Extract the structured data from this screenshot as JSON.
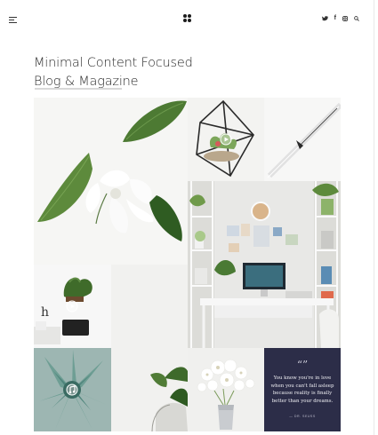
{
  "header": {
    "menu_icon": "hamburger-icon",
    "logo_icon": "four-dot-logo",
    "social": [
      {
        "name": "twitter-icon",
        "glyph": "ⓣ",
        "label": "y"
      },
      {
        "name": "facebook-icon",
        "glyph": "f",
        "label": "f"
      },
      {
        "name": "instagram-icon",
        "glyph": "▢",
        "label": "□"
      },
      {
        "name": "search-icon",
        "glyph": "⌕",
        "label": "⌕"
      }
    ]
  },
  "page": {
    "title_line1": "Minimal Content Focused",
    "title_line2": "Blog & Magazine"
  },
  "grid": {
    "quote": {
      "mark": "“”",
      "text": "You know you're in love when you can't fall asleep because reality is finally better than your dreams.",
      "author": "— DR. SEUSS"
    },
    "format_icons": [
      "video-play-icon",
      "video-play-icon",
      "audio-note-icon"
    ]
  },
  "colors": {
    "quote_bg": "#2c2d48",
    "succulent_bg": "#9db6b2",
    "accent_dark": "#1c1c1c"
  }
}
